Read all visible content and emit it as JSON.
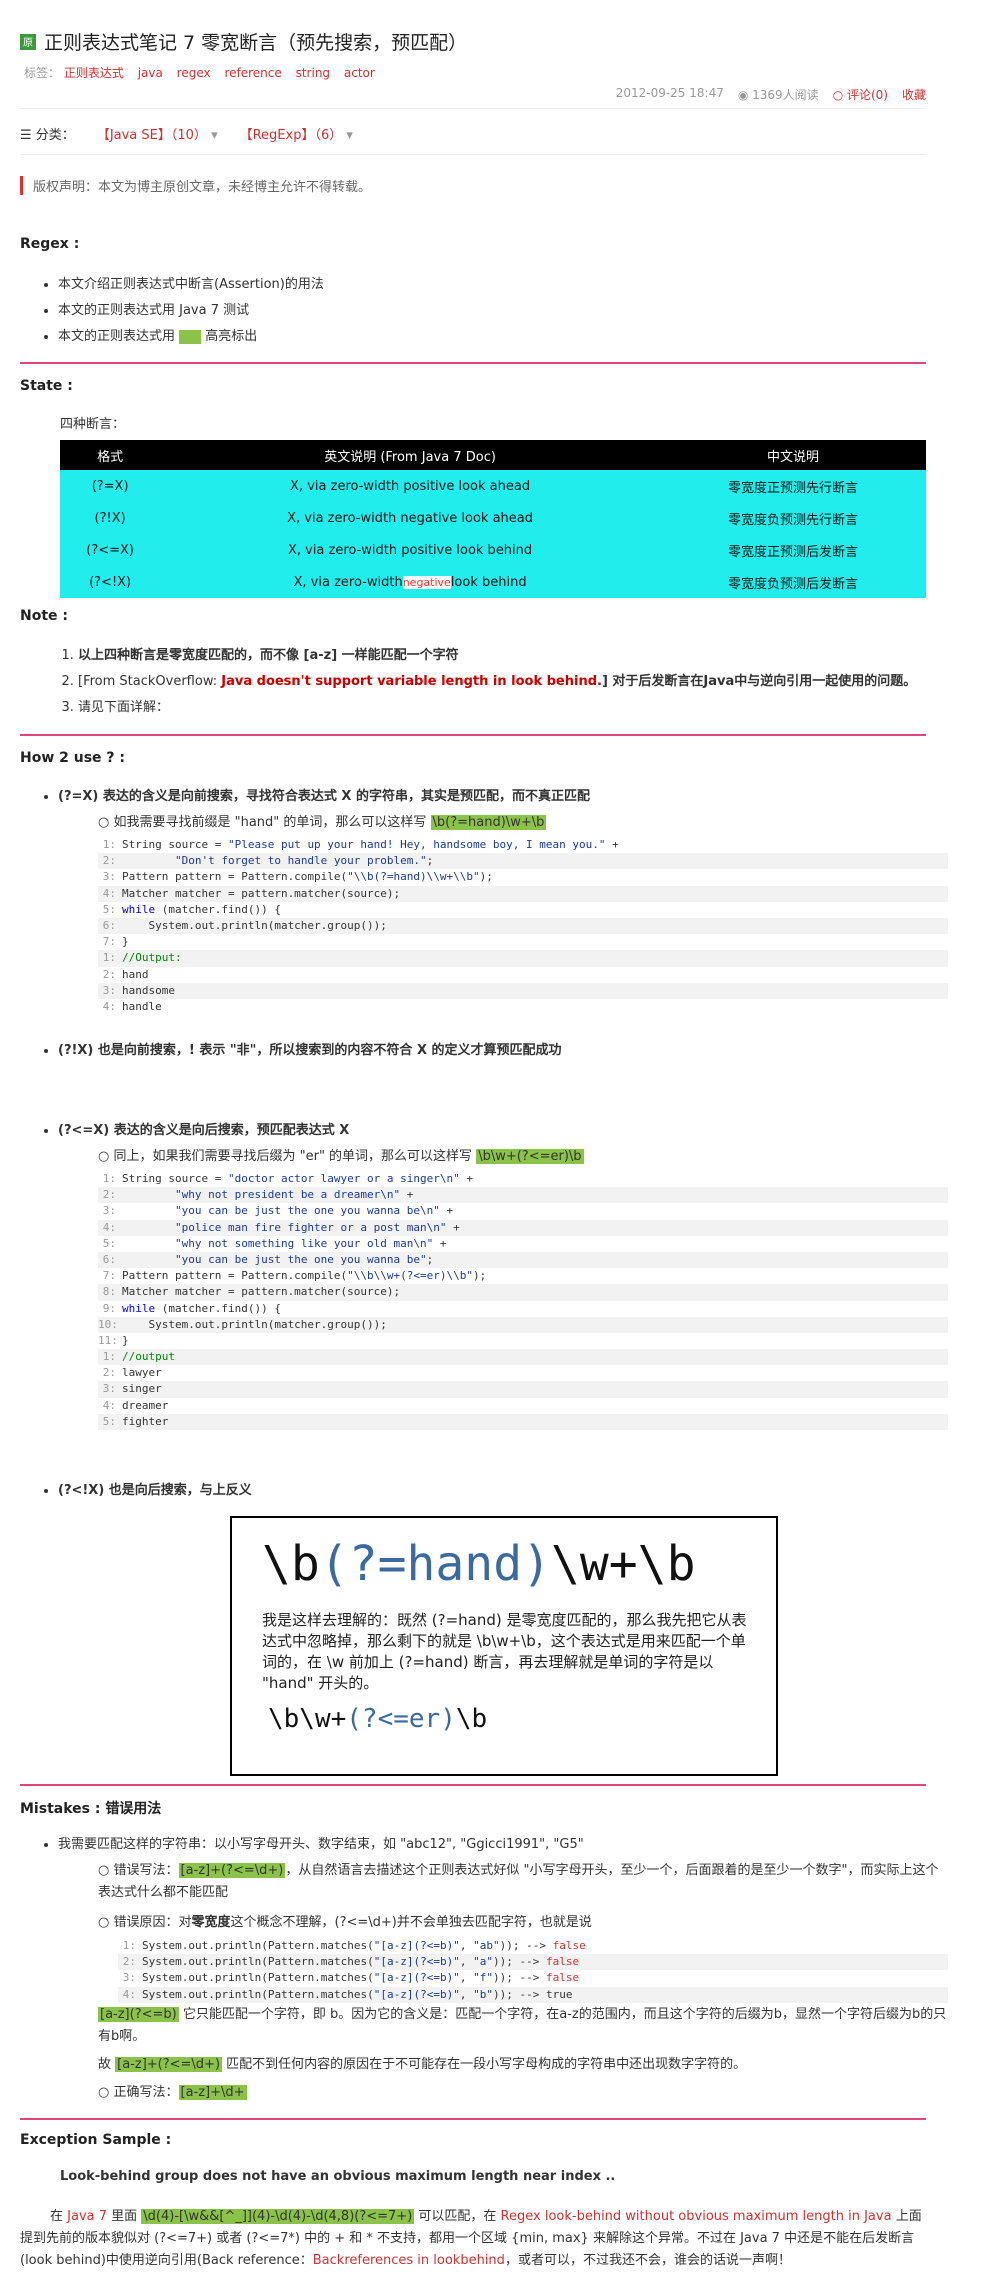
{
  "header": {
    "badge": "原",
    "title": "正则表达式笔记 7 零宽断言（预先搜索，预匹配）",
    "tags_label": "标签：",
    "tags": [
      "正则表达式",
      "java",
      "regex",
      "reference",
      "string",
      "actor"
    ],
    "date": "2012-09-25 18:47",
    "reads": "1369人阅读",
    "comments": "评论(0)",
    "favorite": "收藏"
  },
  "category": {
    "label": "分类：",
    "items": [
      "【Java SE】（10）",
      "【RegExp】（6）"
    ]
  },
  "copyright": "版权声明：本文为博主原创文章，未经博主允许不得转载。",
  "regex": {
    "heading": "Regex :",
    "items": [
      "本文介绍正则表达式中断言(Assertion)的用法",
      "本文的正则表达式用 Java 7 测试",
      "本文的正则表达式用",
      "高亮标出"
    ]
  },
  "state": {
    "heading": "State :",
    "intro": "四种断言：",
    "columns": [
      "格式",
      "英文说明 (From Java 7 Doc)",
      "中文说明"
    ],
    "rows": [
      [
        "(?=X)",
        "X, via zero-width positive look ahead",
        "零宽度正预测先行断言"
      ],
      [
        "(?!X)",
        "X, via zero-width negative look ahead",
        "零宽度负预测先行断言"
      ],
      [
        "(?<=X)",
        "X, via zero-width positive look behind",
        "零宽度正预测后发断言"
      ],
      [
        "(?<!X)",
        "X, via zero-width",
        "look behind",
        "零宽度负预测后发断言"
      ]
    ],
    "negative_note": "negative"
  },
  "note": {
    "heading": "Note :",
    "items": [
      "以上四种断言是零宽度匹配的，而不像 [a-z] 一样能匹配一个字符",
      "[From StackOverflow: ",
      "Java doesn't support variable length in look behind.",
      "] 对于后发断言在Java中与逆向引用一起使用的问题。",
      "请见下面详解："
    ]
  },
  "how": {
    "heading": "How 2 use ? :",
    "b1": "(?=X) 表达的含义是向前搜索，寻找符合表达式 X 的字符串，其实是预匹配，而不真正匹配",
    "b1_sub": "如我需要寻找前缀是 \"hand\" 的单词，那么可以这样写",
    "b1_regex": "\\b(?=hand)\\w+\\b",
    "code1": [
      [
        "1:",
        "String source = \"Please put up your hand! Hey, handsome boy, I mean you.\" +"
      ],
      [
        "2:",
        "        \"Don't forget to handle your problem.\";"
      ],
      [
        "3:",
        "Pattern pattern = Pattern.compile(\"\\\\b(?=hand)\\\\w+\\\\b\");"
      ],
      [
        "4:",
        "Matcher matcher = pattern.matcher(source);"
      ],
      [
        "5:",
        "while (matcher.find()) {"
      ],
      [
        "6:",
        "    System.out.println(matcher.group());"
      ],
      [
        "7:",
        "}"
      ],
      [
        "1:",
        "//Output:"
      ],
      [
        "2:",
        "hand"
      ],
      [
        "3:",
        "handsome"
      ],
      [
        "4:",
        "handle"
      ]
    ],
    "b2": "(?!X) 也是向前搜索，! 表示 \"非\"，所以搜索到的内容不符合 X 的定义才算预匹配成功",
    "b3": "(?<=X) 表达的含义是向后搜索，预匹配表达式 X",
    "b3_sub": "同上，如果我们需要寻找后缀为 \"er\" 的单词，那么可以这样写",
    "b3_regex": "\\b\\w+(?<=er)\\b",
    "code2": [
      [
        "1:",
        "String source = \"doctor actor lawyer or a singer\\n\" +"
      ],
      [
        "2:",
        "        \"why not president be a dreamer\\n\" +"
      ],
      [
        "3:",
        "        \"you can be just the one you wanna be\\n\" +"
      ],
      [
        "4:",
        "        \"police man fire fighter or a post man\\n\" +"
      ],
      [
        "5:",
        "        \"why not something like your old man\\n\" +"
      ],
      [
        "6:",
        "        \"you can be just the one you wanna be\";"
      ],
      [
        "7:",
        "Pattern pattern = Pattern.compile(\"\\\\b\\\\w+(?<=er)\\\\b\");"
      ],
      [
        "8:",
        "Matcher matcher = pattern.matcher(source);"
      ],
      [
        "9:",
        "while (matcher.find()) {"
      ],
      [
        "10:",
        "    System.out.println(matcher.group());"
      ],
      [
        "11:",
        "}"
      ],
      [
        "1:",
        "//output"
      ],
      [
        "2:",
        "lawyer"
      ],
      [
        "3:",
        "singer"
      ],
      [
        "4:",
        "dreamer"
      ],
      [
        "5:",
        "fighter"
      ]
    ],
    "b4": "(?<!X) 也是向后搜索，与上反义",
    "image": {
      "big": [
        "\\b",
        "(?=hand)",
        "\\w+\\b"
      ],
      "desc": "我是这样去理解的：既然 (?=hand) 是零宽度匹配的，那么我先把它从表达式中忽略掉，那么剩下的就是 \\b\\w+\\b，这个表达式是用来匹配一个单词的，在 \\w 前加上 (?=hand) 断言，再去理解就是单词的字符是以 \"hand\" 开头的。",
      "small": [
        "\\b\\w+",
        "(?<=er)",
        "\\b"
      ]
    }
  },
  "mistakes": {
    "heading": "Mistakes : 错误用法",
    "b1": "我需要匹配这样的字符串：以小写字母开头、数字结束，如 \"abc12\", \"Ggicci1991\", \"G5\"",
    "wrong_label": "错误写法：",
    "wrong_regex": "[a-z]+(?<=\\d+)",
    "wrong_text": "，从自然语言去描述这个正则表达式好似 \"小写字母开头，至少一个，后面跟着的是至少一个数字\"，而实际上这个表达式什么都不能匹配",
    "reason_label": "错误原因：对",
    "reason_bold": "零宽度",
    "reason_text": "这个概念不理解，(?<=\\d+)并不会单独去匹配字符，也就是说",
    "code3": [
      [
        "1:",
        "System.out.println(Pattern.matches(\"[a-z](?<=b)\", \"ab\")); --> ",
        "false"
      ],
      [
        "2:",
        "System.out.println(Pattern.matches(\"[a-z](?<=b)\", \"a\")); --> ",
        "false"
      ],
      [
        "3:",
        "System.out.println(Pattern.matches(\"[a-z](?<=b)\", \"f\")); --> ",
        "false"
      ],
      [
        "4:",
        "System.out.println(Pattern.matches(\"[a-z](?<=b)\", \"b\")); --> ",
        "true"
      ]
    ],
    "exp_regex": "[a-z](?<=b)",
    "exp_text": " 它只能匹配一个字符，即 b。因为它的含义是：匹配一个字符，在a-z的范围内，而且这个字符的后缀为b，显然一个字符后缀为b的只有b啊。",
    "therefore_a": "故 ",
    "therefore_regex": "[a-z]+(?<=\\d+)",
    "therefore_b": " 匹配不到任何内容的原因在于不可能存在一段小写字母构成的字符串中还出现数字字符的。",
    "right_label": "正确写法：",
    "right_regex": "[a-z]+\\d+"
  },
  "exception": {
    "heading": "Exception Sample :",
    "message": "Look-behind group does not have an obvious maximum length near index ..",
    "p1": "在 ",
    "java7": "Java 7",
    "p2": " 里面 ",
    "regex": "\\d(4)-[\\w&&[^_]](4)-\\d(4)-\\d(4,8)(?<=7+)",
    "p3": " 可以匹配，在 ",
    "link": "Regex look-behind without obvious maximum length in Java",
    "p4": " 上面提到先前的版本貌似对 (?<=7+) 或者 (?<=7*) 中的 + 和 * 不支持，都用一个区域 {min, max} 来解除这个异常。不过在 Java 7 中还是不能在后发断言(look behind)中使用逆向引用(Back reference：",
    "link2": "Backreferences in lookbehind",
    "p5": "，或者可以，不过我还不会，谁会的话说一声啊！"
  }
}
